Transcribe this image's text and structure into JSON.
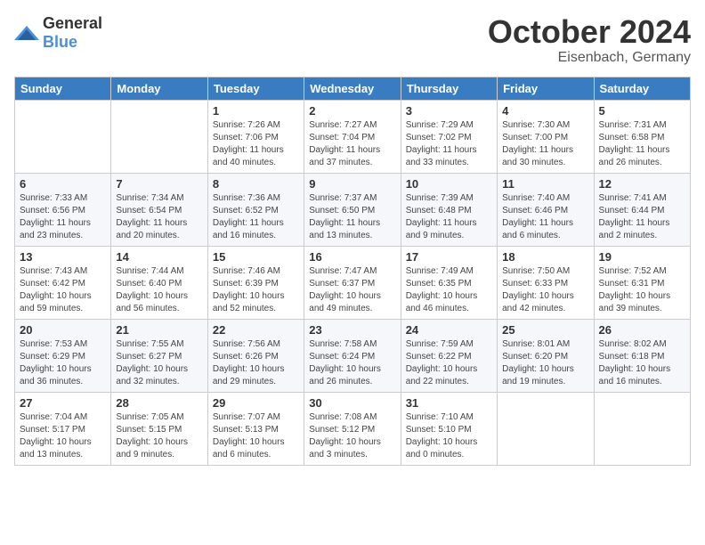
{
  "logo": {
    "text_general": "General",
    "text_blue": "Blue"
  },
  "title": {
    "month": "October 2024",
    "location": "Eisenbach, Germany"
  },
  "weekdays": [
    "Sunday",
    "Monday",
    "Tuesday",
    "Wednesday",
    "Thursday",
    "Friday",
    "Saturday"
  ],
  "weeks": [
    [
      {
        "day": "",
        "sunrise": "",
        "sunset": "",
        "daylight": ""
      },
      {
        "day": "",
        "sunrise": "",
        "sunset": "",
        "daylight": ""
      },
      {
        "day": "1",
        "sunrise": "Sunrise: 7:26 AM",
        "sunset": "Sunset: 7:06 PM",
        "daylight": "Daylight: 11 hours and 40 minutes."
      },
      {
        "day": "2",
        "sunrise": "Sunrise: 7:27 AM",
        "sunset": "Sunset: 7:04 PM",
        "daylight": "Daylight: 11 hours and 37 minutes."
      },
      {
        "day": "3",
        "sunrise": "Sunrise: 7:29 AM",
        "sunset": "Sunset: 7:02 PM",
        "daylight": "Daylight: 11 hours and 33 minutes."
      },
      {
        "day": "4",
        "sunrise": "Sunrise: 7:30 AM",
        "sunset": "Sunset: 7:00 PM",
        "daylight": "Daylight: 11 hours and 30 minutes."
      },
      {
        "day": "5",
        "sunrise": "Sunrise: 7:31 AM",
        "sunset": "Sunset: 6:58 PM",
        "daylight": "Daylight: 11 hours and 26 minutes."
      }
    ],
    [
      {
        "day": "6",
        "sunrise": "Sunrise: 7:33 AM",
        "sunset": "Sunset: 6:56 PM",
        "daylight": "Daylight: 11 hours and 23 minutes."
      },
      {
        "day": "7",
        "sunrise": "Sunrise: 7:34 AM",
        "sunset": "Sunset: 6:54 PM",
        "daylight": "Daylight: 11 hours and 20 minutes."
      },
      {
        "day": "8",
        "sunrise": "Sunrise: 7:36 AM",
        "sunset": "Sunset: 6:52 PM",
        "daylight": "Daylight: 11 hours and 16 minutes."
      },
      {
        "day": "9",
        "sunrise": "Sunrise: 7:37 AM",
        "sunset": "Sunset: 6:50 PM",
        "daylight": "Daylight: 11 hours and 13 minutes."
      },
      {
        "day": "10",
        "sunrise": "Sunrise: 7:39 AM",
        "sunset": "Sunset: 6:48 PM",
        "daylight": "Daylight: 11 hours and 9 minutes."
      },
      {
        "day": "11",
        "sunrise": "Sunrise: 7:40 AM",
        "sunset": "Sunset: 6:46 PM",
        "daylight": "Daylight: 11 hours and 6 minutes."
      },
      {
        "day": "12",
        "sunrise": "Sunrise: 7:41 AM",
        "sunset": "Sunset: 6:44 PM",
        "daylight": "Daylight: 11 hours and 2 minutes."
      }
    ],
    [
      {
        "day": "13",
        "sunrise": "Sunrise: 7:43 AM",
        "sunset": "Sunset: 6:42 PM",
        "daylight": "Daylight: 10 hours and 59 minutes."
      },
      {
        "day": "14",
        "sunrise": "Sunrise: 7:44 AM",
        "sunset": "Sunset: 6:40 PM",
        "daylight": "Daylight: 10 hours and 56 minutes."
      },
      {
        "day": "15",
        "sunrise": "Sunrise: 7:46 AM",
        "sunset": "Sunset: 6:39 PM",
        "daylight": "Daylight: 10 hours and 52 minutes."
      },
      {
        "day": "16",
        "sunrise": "Sunrise: 7:47 AM",
        "sunset": "Sunset: 6:37 PM",
        "daylight": "Daylight: 10 hours and 49 minutes."
      },
      {
        "day": "17",
        "sunrise": "Sunrise: 7:49 AM",
        "sunset": "Sunset: 6:35 PM",
        "daylight": "Daylight: 10 hours and 46 minutes."
      },
      {
        "day": "18",
        "sunrise": "Sunrise: 7:50 AM",
        "sunset": "Sunset: 6:33 PM",
        "daylight": "Daylight: 10 hours and 42 minutes."
      },
      {
        "day": "19",
        "sunrise": "Sunrise: 7:52 AM",
        "sunset": "Sunset: 6:31 PM",
        "daylight": "Daylight: 10 hours and 39 minutes."
      }
    ],
    [
      {
        "day": "20",
        "sunrise": "Sunrise: 7:53 AM",
        "sunset": "Sunset: 6:29 PM",
        "daylight": "Daylight: 10 hours and 36 minutes."
      },
      {
        "day": "21",
        "sunrise": "Sunrise: 7:55 AM",
        "sunset": "Sunset: 6:27 PM",
        "daylight": "Daylight: 10 hours and 32 minutes."
      },
      {
        "day": "22",
        "sunrise": "Sunrise: 7:56 AM",
        "sunset": "Sunset: 6:26 PM",
        "daylight": "Daylight: 10 hours and 29 minutes."
      },
      {
        "day": "23",
        "sunrise": "Sunrise: 7:58 AM",
        "sunset": "Sunset: 6:24 PM",
        "daylight": "Daylight: 10 hours and 26 minutes."
      },
      {
        "day": "24",
        "sunrise": "Sunrise: 7:59 AM",
        "sunset": "Sunset: 6:22 PM",
        "daylight": "Daylight: 10 hours and 22 minutes."
      },
      {
        "day": "25",
        "sunrise": "Sunrise: 8:01 AM",
        "sunset": "Sunset: 6:20 PM",
        "daylight": "Daylight: 10 hours and 19 minutes."
      },
      {
        "day": "26",
        "sunrise": "Sunrise: 8:02 AM",
        "sunset": "Sunset: 6:18 PM",
        "daylight": "Daylight: 10 hours and 16 minutes."
      }
    ],
    [
      {
        "day": "27",
        "sunrise": "Sunrise: 7:04 AM",
        "sunset": "Sunset: 5:17 PM",
        "daylight": "Daylight: 10 hours and 13 minutes."
      },
      {
        "day": "28",
        "sunrise": "Sunrise: 7:05 AM",
        "sunset": "Sunset: 5:15 PM",
        "daylight": "Daylight: 10 hours and 9 minutes."
      },
      {
        "day": "29",
        "sunrise": "Sunrise: 7:07 AM",
        "sunset": "Sunset: 5:13 PM",
        "daylight": "Daylight: 10 hours and 6 minutes."
      },
      {
        "day": "30",
        "sunrise": "Sunrise: 7:08 AM",
        "sunset": "Sunset: 5:12 PM",
        "daylight": "Daylight: 10 hours and 3 minutes."
      },
      {
        "day": "31",
        "sunrise": "Sunrise: 7:10 AM",
        "sunset": "Sunset: 5:10 PM",
        "daylight": "Daylight: 10 hours and 0 minutes."
      },
      {
        "day": "",
        "sunrise": "",
        "sunset": "",
        "daylight": ""
      },
      {
        "day": "",
        "sunrise": "",
        "sunset": "",
        "daylight": ""
      }
    ]
  ]
}
